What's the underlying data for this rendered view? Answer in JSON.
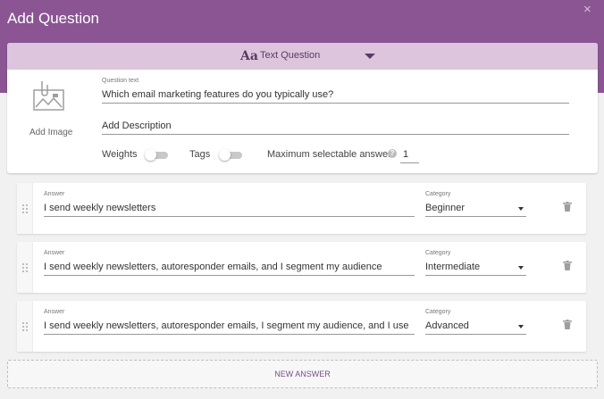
{
  "dialog": {
    "title": "Add Question",
    "close_icon": "×"
  },
  "question_type": {
    "icon": "Aa",
    "label": "Text Question"
  },
  "question": {
    "add_image_label": "Add Image",
    "text_label": "Question text",
    "text_value": "Which email marketing features do you typically use?",
    "description_placeholder": "Add Description"
  },
  "options": {
    "weights_label": "Weights",
    "tags_label": "Tags",
    "max_label": "Maximum selectable answers",
    "help_icon": "?",
    "max_value": "1"
  },
  "answers": [
    {
      "label": "Answer",
      "value": "I send weekly newsletters",
      "category_label": "Category",
      "category": "Beginner"
    },
    {
      "label": "Answer",
      "value": "I send weekly newsletters, autoresponder emails, and I segment my audience",
      "category_label": "Category",
      "category": "Intermediate"
    },
    {
      "label": "Answer",
      "value": "I send weekly newsletters, autoresponder emails, I segment my audience, and I use an automa",
      "category_label": "Category",
      "category": "Advanced"
    }
  ],
  "new_answer_label": "NEW ANSWER",
  "colors": {
    "header": "#8a5592",
    "type_bar": "#dcc5dd",
    "accent": "#5a3b63"
  }
}
